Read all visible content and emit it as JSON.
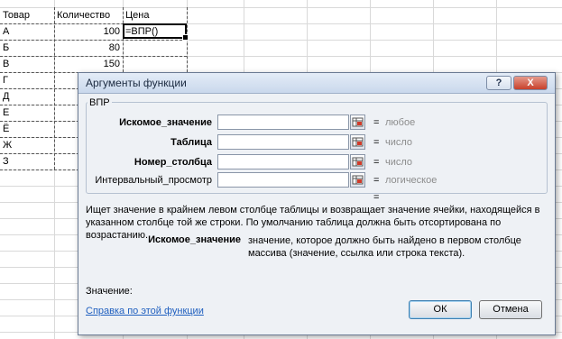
{
  "sheet": {
    "headers": [
      "Товар",
      "Количество",
      "Цена"
    ],
    "rows": [
      {
        "product": "А",
        "qty": "100",
        "price": "=ВПР()"
      },
      {
        "product": "Б",
        "qty": "80",
        "price": ""
      },
      {
        "product": "В",
        "qty": "150",
        "price": ""
      },
      {
        "product": "Г",
        "qty": "",
        "price": ""
      },
      {
        "product": "Д",
        "qty": "",
        "price": ""
      },
      {
        "product": "Е",
        "qty": "",
        "price": ""
      },
      {
        "product": "Ё",
        "qty": "",
        "price": ""
      },
      {
        "product": "Ж",
        "qty": "",
        "price": ""
      },
      {
        "product": "З",
        "qty": "",
        "price": ""
      }
    ]
  },
  "dialog": {
    "title": "Аргументы функции",
    "help_button": "?",
    "close_button": "X",
    "function_name": "ВПР",
    "args": [
      {
        "label": "Искомое_значение",
        "bold": true,
        "eq": "=",
        "type": "любое"
      },
      {
        "label": "Таблица",
        "bold": true,
        "eq": "=",
        "type": "число"
      },
      {
        "label": "Номер_столбца",
        "bold": true,
        "eq": "=",
        "type": "число"
      },
      {
        "label": "Интервальный_просмотр",
        "bold": false,
        "eq": "=",
        "type": "логическое"
      }
    ],
    "result_eq": "=",
    "description": "Ищет значение в крайнем левом столбце таблицы и возвращает значение ячейки, находящейся в указанном столбце той же строки. По умолчанию таблица должна быть отсортирована по возрастанию.",
    "current_arg_name": "Искомое_значение",
    "current_arg_desc": "значение, которое должно быть найдено в первом столбце массива (значение, ссылка или строка текста).",
    "value_label": "Значение:",
    "help_link": "Справка по этой функции",
    "ok_label": "ОК",
    "cancel_label": "Отмена"
  }
}
